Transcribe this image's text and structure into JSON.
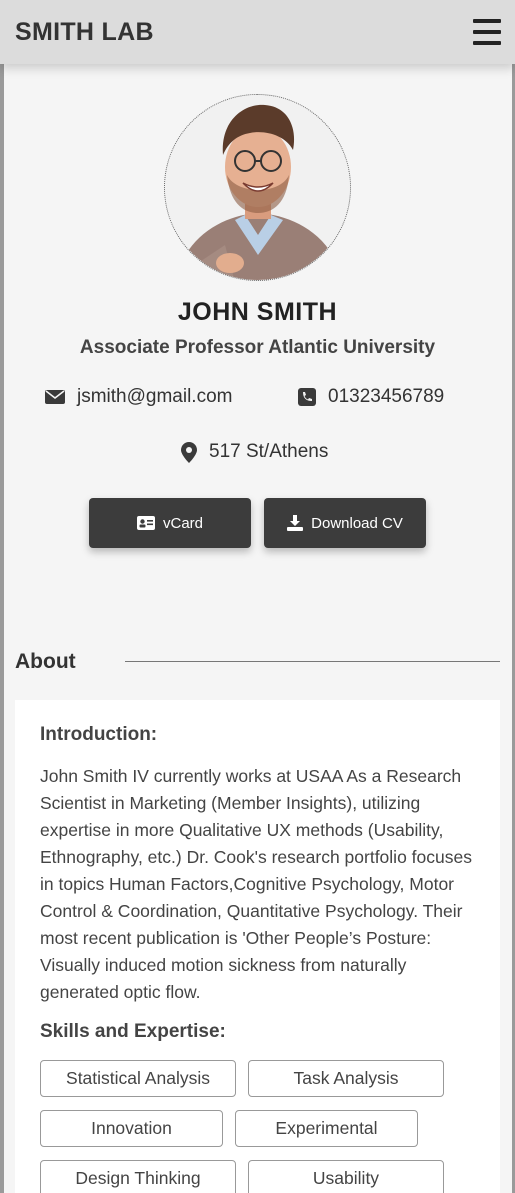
{
  "header": {
    "brand": "SMITH LAB"
  },
  "profile": {
    "name": "JOHN SMITH",
    "role": "Associate Professor Atlantic University",
    "email": "jsmith@gmail.com",
    "phone": "01323456789",
    "address": "517 St/Athens"
  },
  "actions": {
    "vcard_label": "vCard",
    "cv_label": "Download CV"
  },
  "about": {
    "title": "About",
    "intro_heading": "Introduction:",
    "intro_text": "John Smith IV currently works at USAA As a Research Scientist in Marketing (Member Insights), utilizing expertise in more Qualitative UX methods (Usability, Ethnography, etc.) Dr. Cook's research portfolio focuses in topics Human Factors,Cognitive Psychology, Motor Control & Coordination, Quantitative Psychology. Their most recent publication is 'Other People’s Posture: Visually induced motion sickness from naturally generated optic flow.",
    "skills_heading": "Skills and Expertise:",
    "skills": [
      "Statistical Analysis",
      "Task Analysis",
      "Innovation",
      "Experimental",
      "Design Thinking",
      "Usability"
    ]
  },
  "icons": {
    "menu": "menu-icon",
    "email": "envelope-icon",
    "phone": "phone-icon",
    "address": "map-pin-icon",
    "vcard": "id-card-icon",
    "download": "download-icon"
  },
  "colors": {
    "topbar": "#dcdcdc",
    "button": "#3c3c3c",
    "background": "#f5f5f5"
  }
}
